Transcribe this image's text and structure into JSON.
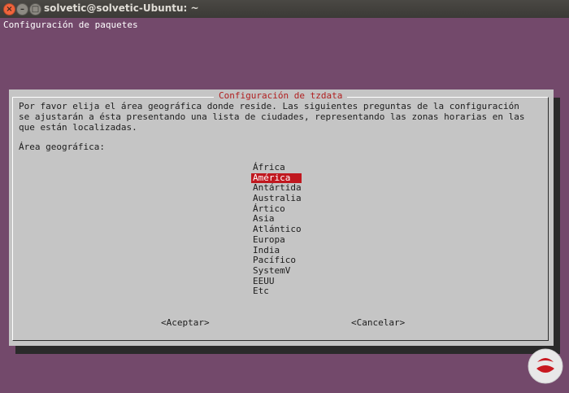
{
  "window": {
    "title": "solvetic@solvetic-Ubuntu: ~",
    "controls": {
      "close": "×",
      "minimize": "–",
      "maximize": "□"
    }
  },
  "terminal": {
    "header": "Configuración de paquetes",
    "background_color": "#73496b"
  },
  "dialog": {
    "title": "Configuración de tzdata",
    "description": "Por favor elija el área geográfica donde reside. Las siguientes preguntas de la configuración\nse ajustarán a ésta presentando una lista de ciudades, representando las zonas horarias en las\nque están localizadas.",
    "label": "Área geográfica:",
    "options": [
      "África",
      "América",
      "Antártida",
      "Australia",
      "Ártico",
      "Asia",
      "Atlántico",
      "Europa",
      "India",
      "Pacífico",
      "SystemV",
      "EEUU",
      "Etc"
    ],
    "selected_index": 1,
    "buttons": {
      "ok": "<Aceptar>",
      "cancel": "<Cancelar>"
    },
    "accent_color": "#c0181f"
  },
  "watermark": {
    "icon": "solvetic-logo"
  }
}
